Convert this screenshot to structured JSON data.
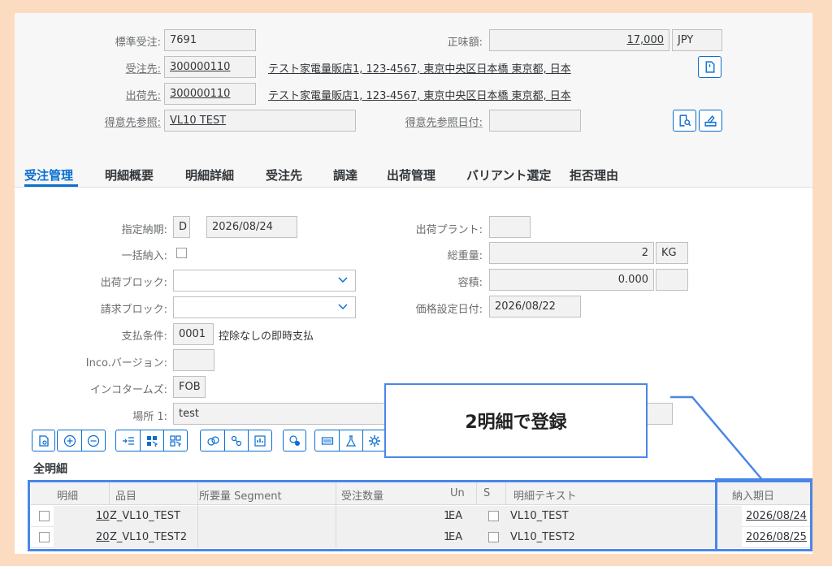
{
  "header": {
    "std_order_label": "標準受注",
    "std_order_value": "7691",
    "net_value_label": "正味額",
    "net_value_value": "17,000",
    "currency": "JPY",
    "sold_to_label": "受注先",
    "sold_to_value": "300000110",
    "sold_to_address": "テスト家電量販店1, 123-4567, 東京中央区日本橋 東京都, 日本",
    "ship_to_label": "出荷先",
    "ship_to_value": "300000110",
    "ship_to_address": "テスト家電量販店1, 123-4567, 東京中央区日本橋 東京都, 日本",
    "cust_ref_label": "得意先参照",
    "cust_ref_value": "VL10 TEST",
    "cust_ref_date_label": "得意先参照日付",
    "cust_ref_date_value": ""
  },
  "tabs": [
    {
      "label": "受注管理"
    },
    {
      "label": "明細概要"
    },
    {
      "label": "明細詳細"
    },
    {
      "label": "受注先"
    },
    {
      "label": "調達"
    },
    {
      "label": "出荷管理"
    },
    {
      "label": "バリアント選定"
    },
    {
      "label": "拒否理由"
    }
  ],
  "form": {
    "req_deliv_label": "指定納期",
    "req_deliv_type": "D",
    "req_deliv_date": "2026/08/24",
    "complete_deliv_label": "一括納入",
    "delivery_block_label": "出荷ブロック",
    "billing_block_label": "請求ブロック",
    "payment_terms_label": "支払条件",
    "payment_terms_value": "0001",
    "payment_terms_text": "控除なしの即時支払",
    "inco_version_label": "Inco.バージョン",
    "inco_version_value": "",
    "incoterms_label": "インコタームズ",
    "incoterms_value": "FOB",
    "location_label": "場所 1",
    "location_value": "test",
    "shipping_plant_label": "出荷プラント",
    "shipping_plant_value": "",
    "gross_weight_label": "総重量",
    "gross_weight_value": "2",
    "gross_weight_unit": "KG",
    "volume_label": "容積",
    "volume_value": "0.000",
    "volume_unit": "",
    "pricing_date_label": "価格設定日付",
    "pricing_date_value": "2026/08/22"
  },
  "items_section": {
    "title": "全明細",
    "columns": [
      "明細",
      "品目",
      "所要量 Segment",
      "受注数量",
      "Un",
      "S",
      "明細テキスト",
      "納入期日"
    ],
    "rows": [
      {
        "item": "10",
        "material": "Z_VL10_TEST",
        "segment": "",
        "qty": "1",
        "unit": "EA",
        "text": "VL10_TEST",
        "date": "2026/08/24"
      },
      {
        "item": "20",
        "material": "Z_VL10_TEST2",
        "segment": "",
        "qty": "1",
        "unit": "EA",
        "text": "VL10_TEST2",
        "date": "2026/08/25"
      }
    ]
  },
  "annotation": {
    "callout_text": "2明細で登録"
  },
  "colors": {
    "accent": "#0a6ed1",
    "highlight": "#4a86e8",
    "outer_bg": "#fcdcc0"
  }
}
